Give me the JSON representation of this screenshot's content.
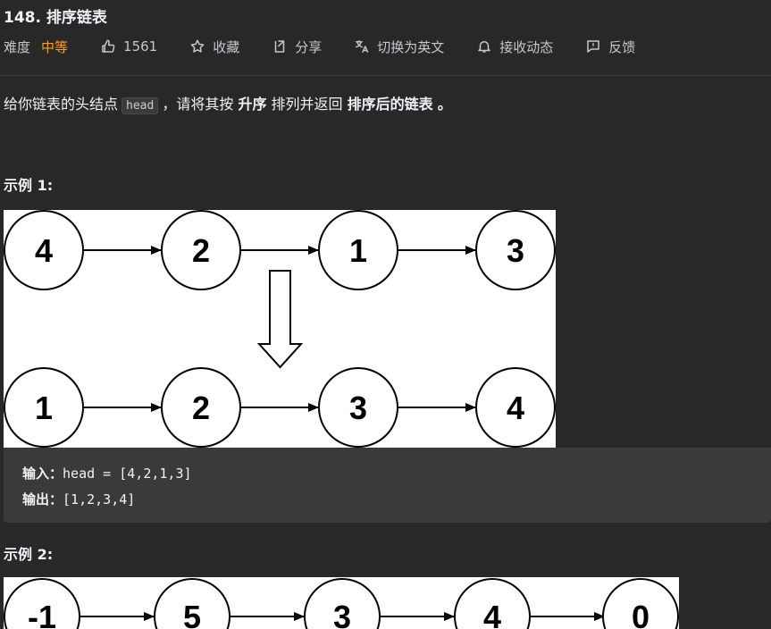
{
  "problem": {
    "title": "148. 排序链表"
  },
  "meta": {
    "difficulty_label": "难度",
    "difficulty_value": "中等",
    "likes": "1561",
    "favorite": "收藏",
    "share": "分享",
    "switch_lang": "切换为英文",
    "notify": "接收动态",
    "feedback": "反馈"
  },
  "description": {
    "part1": "给你链表的头结点",
    "code": "head",
    "part2": "，请将其按",
    "bold1": "升序",
    "part3": "排列并返回",
    "bold2": "排序后的链表",
    "part4": "。"
  },
  "example1": {
    "title": "示例 1:",
    "diagram": {
      "before": [
        "4",
        "2",
        "1",
        "3"
      ],
      "after": [
        "1",
        "2",
        "3",
        "4"
      ]
    },
    "input_label": "输入：",
    "input_value": "head = [4,2,1,3]",
    "output_label": "输出：",
    "output_value": "[1,2,3,4]"
  },
  "example2": {
    "title": "示例 2:",
    "diagram": {
      "before": [
        "-1",
        "5",
        "3",
        "4",
        "0"
      ]
    }
  },
  "colors": {
    "accent": "#ffa116",
    "background": "#282828",
    "code_bg": "#3a3a3a"
  }
}
